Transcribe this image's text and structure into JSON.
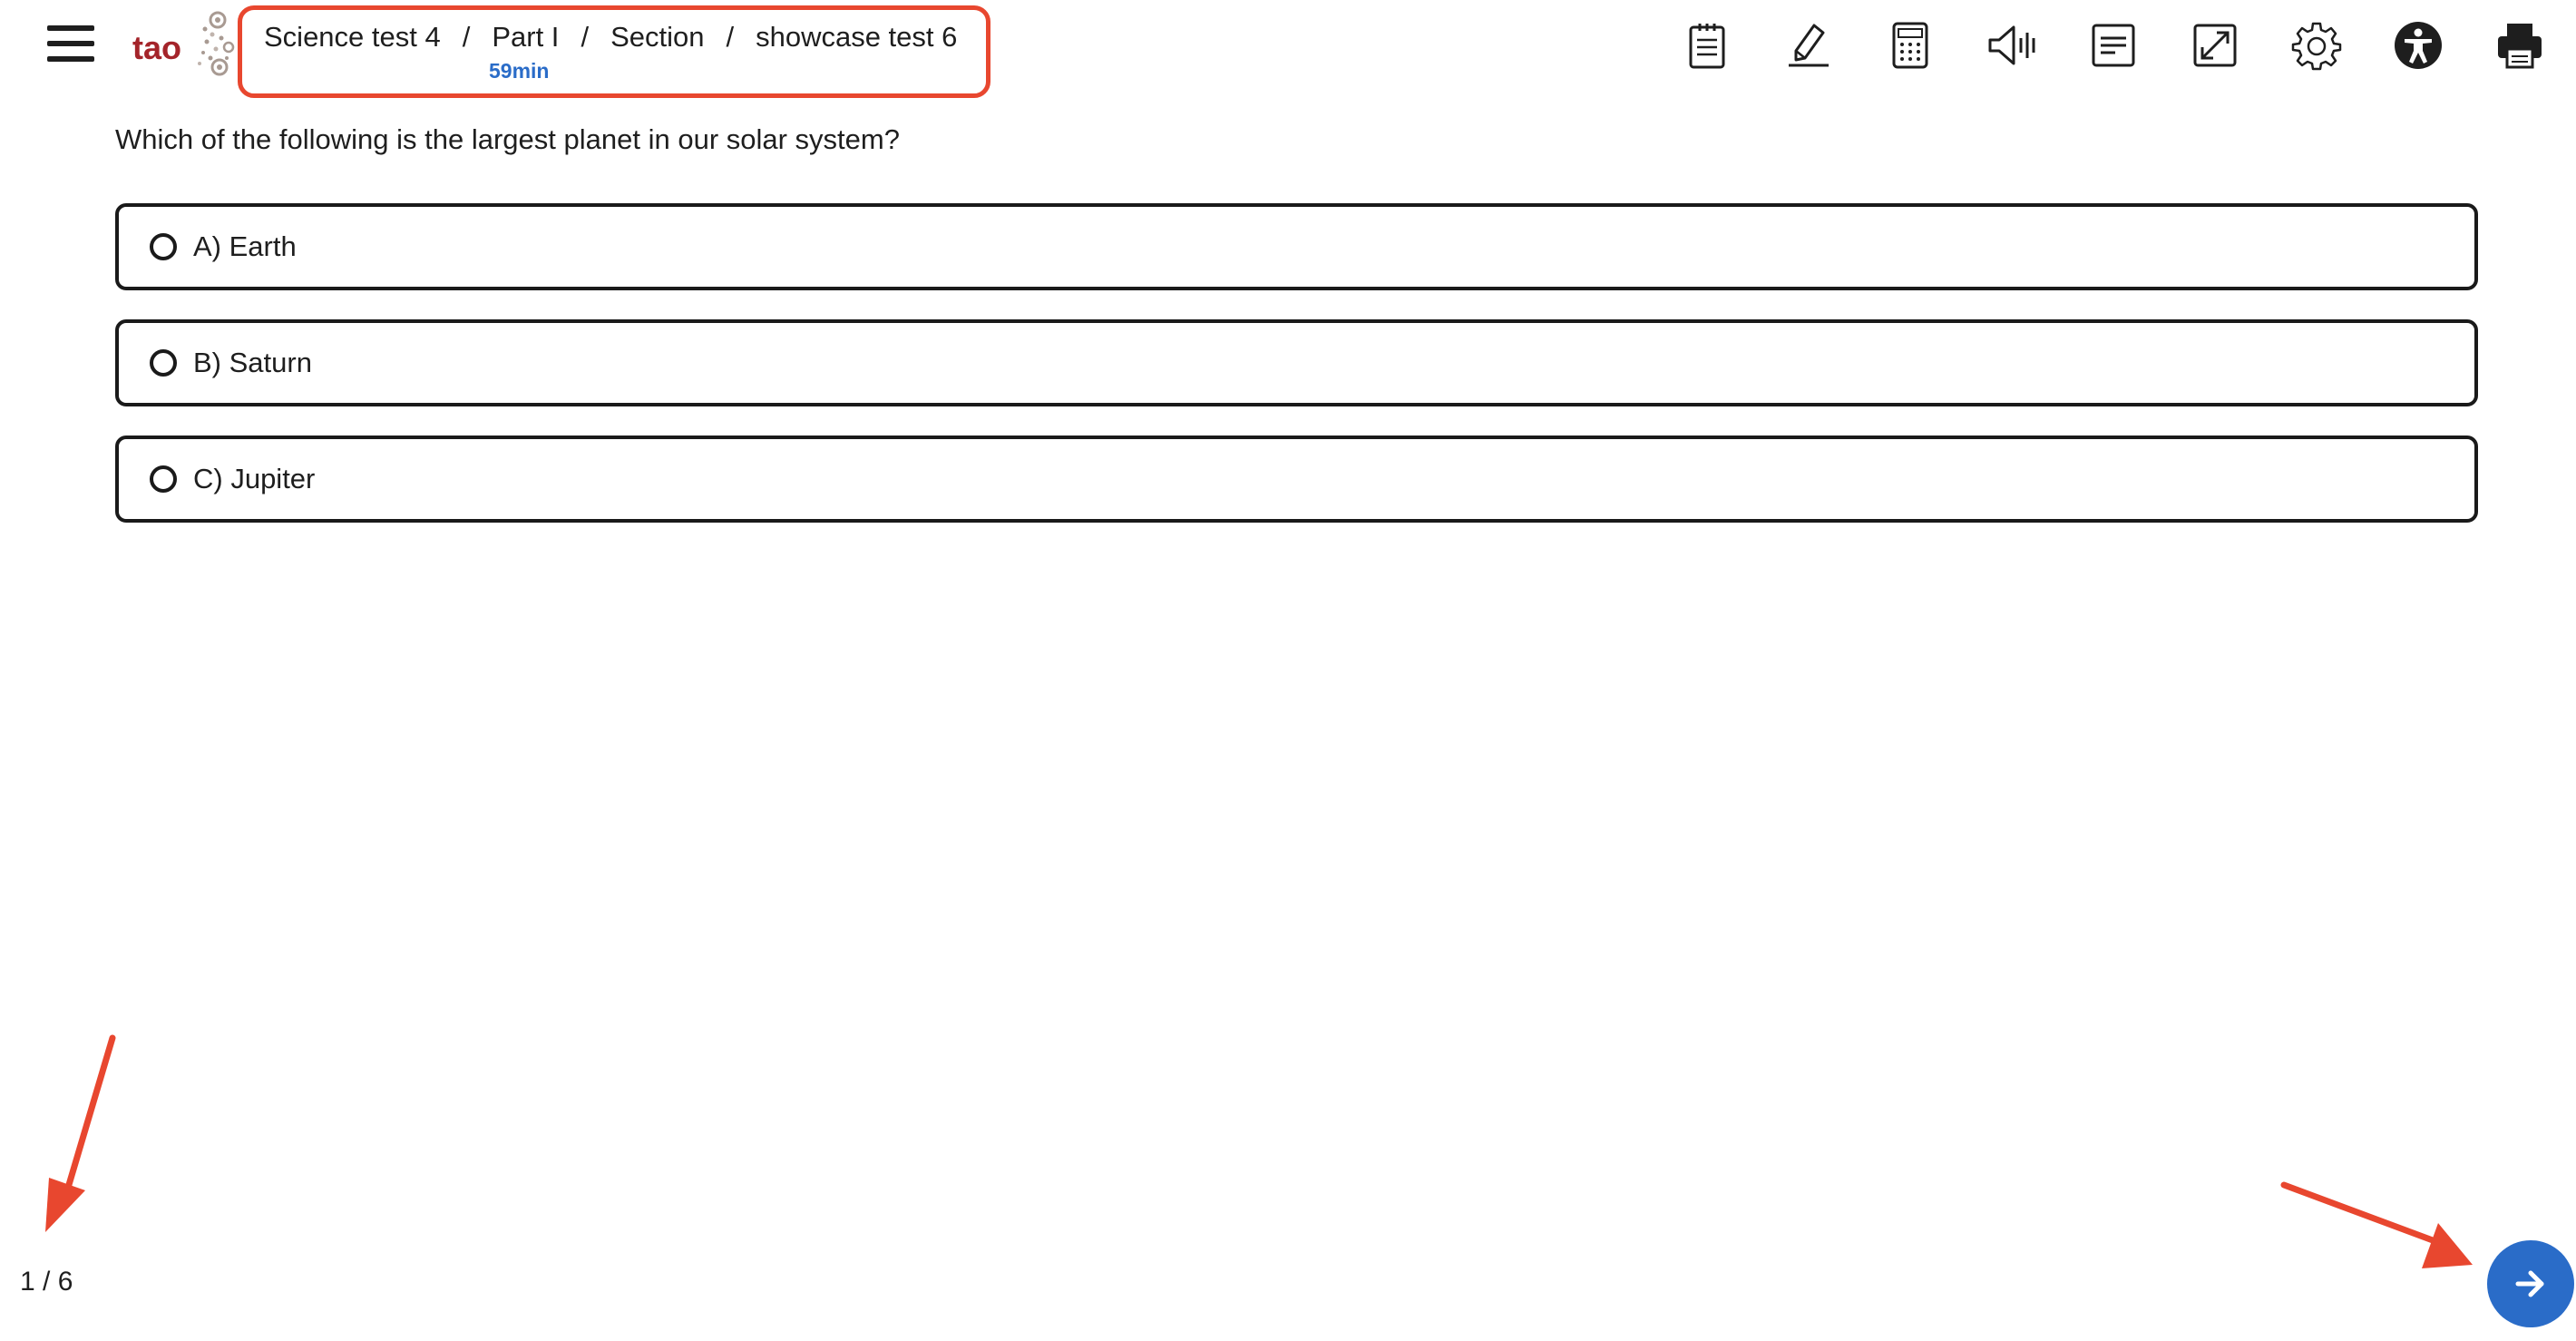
{
  "header": {
    "logo_text": "tao",
    "breadcrumb": [
      "Science test 4",
      "Part I",
      "Section",
      "showcase test 6"
    ],
    "separator": "/",
    "timer": "59min"
  },
  "toolbar": {
    "tools": [
      {
        "icon": "notepad-icon"
      },
      {
        "icon": "highlighter-icon"
      },
      {
        "icon": "calculator-icon"
      },
      {
        "icon": "text-to-speech-icon"
      },
      {
        "icon": "line-reader-icon"
      },
      {
        "icon": "fullscreen-icon"
      },
      {
        "icon": "settings-gear-icon"
      },
      {
        "icon": "accessibility-icon"
      },
      {
        "icon": "print-icon"
      }
    ]
  },
  "question": {
    "text": "Which of the following is the largest planet in our solar system?",
    "choices": [
      {
        "label": "A) Earth"
      },
      {
        "label": "B) Saturn"
      },
      {
        "label": "C) Jupiter"
      }
    ]
  },
  "footer": {
    "progress": "1 / 6",
    "next_icon": "arrow-right-icon"
  },
  "colors": {
    "accent": "#2a6cc8",
    "brand": "#a4242a",
    "annotation": "#e8472f"
  }
}
